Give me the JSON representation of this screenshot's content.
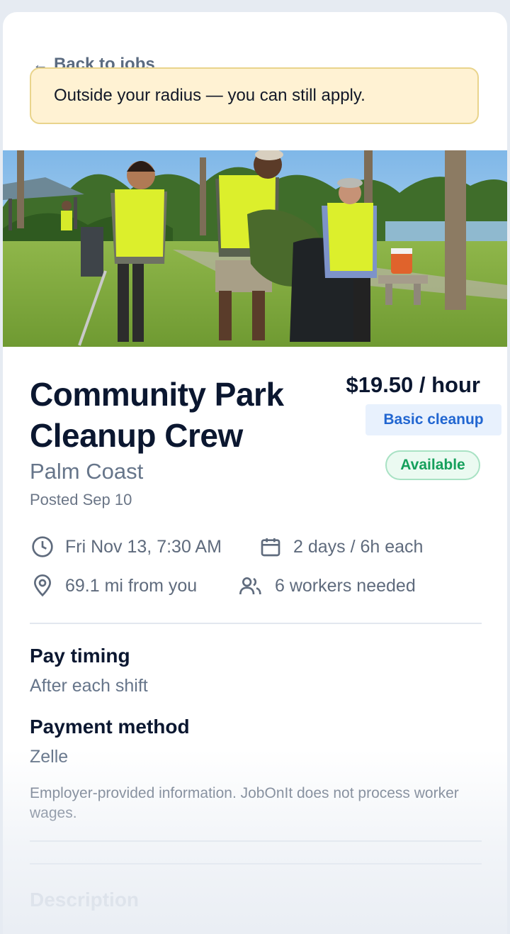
{
  "nav": {
    "back_label": "Back to jobs",
    "back_arrow": "←"
  },
  "notice": {
    "text": "Outside your radius — you can still apply."
  },
  "job": {
    "title": "Community Park Cleanup Crew",
    "city": "Palm Coast",
    "posted": "Posted Sep 10",
    "pay": "$19.50 / hour",
    "category": "Basic cleanup",
    "status": "Available"
  },
  "meta": {
    "start": "Fri Nov 13, 7:30 AM",
    "duration": "2 days / 6h each",
    "distance": "69.1 mi from you",
    "workers": "6 workers needed"
  },
  "pay_info": {
    "timing_label": "Pay timing",
    "timing_value": "After each shift",
    "method_label": "Payment method",
    "method_value": "Zelle",
    "disclaimer": "Employer-provided information. JobOnIt does not process worker wages."
  },
  "description": {
    "label": "Description"
  },
  "icons": [
    "clock-icon",
    "calendar-icon",
    "location-pin-icon",
    "users-icon"
  ],
  "colors": {
    "accent_blue": "#2166d1",
    "available_green": "#16a05c",
    "notice_bg": "#fff2d3"
  }
}
